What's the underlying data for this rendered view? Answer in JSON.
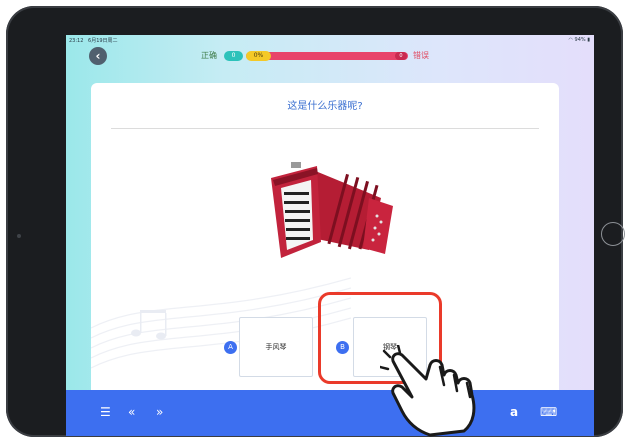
{
  "status_bar": {
    "time": "23:12",
    "date": "6月19日周二",
    "battery": "94%"
  },
  "header": {
    "correct_label": "正确",
    "correct_count": "0",
    "progress_percent": "0%",
    "wrong_count": "0",
    "wrong_label": "错误"
  },
  "question": {
    "text": "这是什么乐器呢?"
  },
  "options": [
    {
      "letter": "A",
      "label": "手风琴"
    },
    {
      "letter": "B",
      "label": "钢琴"
    }
  ],
  "colors": {
    "accent_blue": "#3d6ff0",
    "correct_teal": "#2cc2ba",
    "wrong_red": "#e8436a",
    "progress_yellow": "#f4c928",
    "highlight_red": "#ea3a2a"
  },
  "icons": {
    "back": "chevron-left-icon",
    "toolbar_left": [
      "list-icon",
      "double-chevron-left-icon",
      "double-chevron-right-icon"
    ],
    "toolbar_right": [
      "a-icon",
      "keyboard-icon"
    ],
    "pointer": "pointing-hand-icon"
  }
}
